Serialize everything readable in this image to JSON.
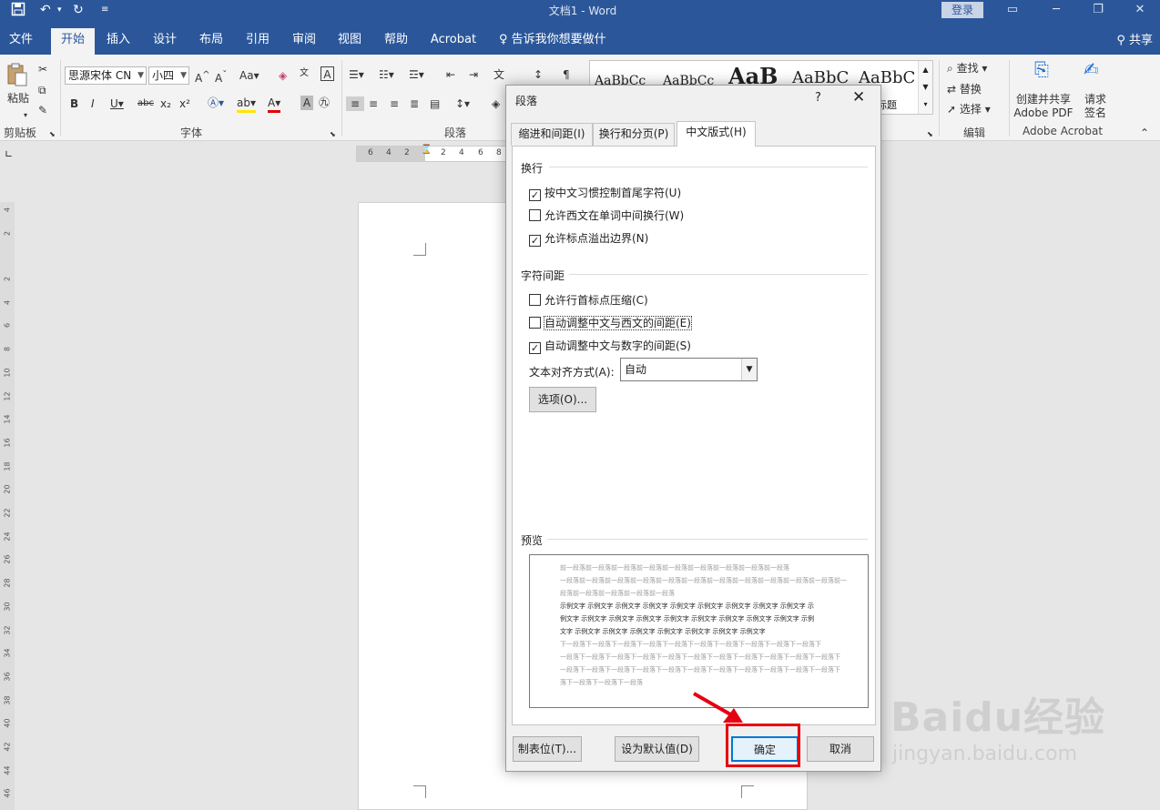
{
  "titlebar": {
    "title": "文档1  -  Word",
    "signin": "登录",
    "save_icon": "save-icon",
    "undo_icon": "undo-icon",
    "redo_icon": "redo-icon",
    "accent": "#2b579a"
  },
  "tabs": [
    {
      "label": "文件"
    },
    {
      "label": "开始"
    },
    {
      "label": "插入"
    },
    {
      "label": "设计"
    },
    {
      "label": "布局"
    },
    {
      "label": "引用"
    },
    {
      "label": "审阅"
    },
    {
      "label": "视图"
    },
    {
      "label": "帮助"
    },
    {
      "label": "Acrobat"
    }
  ],
  "tellme": "告诉我你想要做什么",
  "share": "共享",
  "ribbon": {
    "clipboard": {
      "paste": "粘贴",
      "label": "剪贴板"
    },
    "font": {
      "name": "思源宋体 CN",
      "size": "小四",
      "label": "字体"
    },
    "paragraph": {
      "label": "段落"
    },
    "styles": {
      "samples": [
        "AaBbCc",
        "AaBbCc",
        "AaB",
        "AaBbC",
        "AaBbC"
      ],
      "partial": "标题"
    },
    "editing": {
      "find": "查找",
      "replace": "替换",
      "select": "选择",
      "label": "编辑"
    },
    "acrobat": {
      "create": "创建并共享",
      "create2": "Adobe PDF",
      "request": "请求",
      "request2": "签名",
      "label": "Adobe Acrobat"
    }
  },
  "hruler": [
    "6",
    "4",
    "2",
    "2",
    "4",
    "6",
    "8"
  ],
  "vruler": [
    "4",
    "2",
    "2",
    "4",
    "6",
    "8",
    "10",
    "12",
    "14",
    "16",
    "18",
    "20",
    "22",
    "24",
    "26",
    "28",
    "30",
    "32",
    "34",
    "36",
    "38",
    "40",
    "42",
    "44",
    "46"
  ],
  "dialog": {
    "title": "段落",
    "help": "?",
    "tabs": [
      {
        "label": "缩进和间距(I)",
        "active": false
      },
      {
        "label": "换行和分页(P)",
        "active": false
      },
      {
        "label": "中文版式(H)",
        "active": true
      }
    ],
    "sections": {
      "line_break": "换行",
      "char_spacing": "字符间距",
      "preview": "预览"
    },
    "checks": [
      {
        "label": "按中文习惯控制首尾字符(U)",
        "checked": true
      },
      {
        "label": "允许西文在单词中间换行(W)",
        "checked": false
      },
      {
        "label": "允许标点溢出边界(N)",
        "checked": true
      },
      {
        "label": "允许行首标点压缩(C)",
        "checked": false
      },
      {
        "label": "自动调整中文与西文的间距(E)",
        "checked": false
      },
      {
        "label": "自动调整中文与数字的间距(S)",
        "checked": true
      }
    ],
    "align": {
      "label": "文本对齐方式(A):",
      "value": "自动"
    },
    "options_button": "选项(O)...",
    "preview_text": {
      "before": [
        "前一段落前一段落前一段落前一段落前一段落前一段落前一段落前一段落前一段落",
        "一段落前一段落前一段落前一段落前一段落前一段落前一段落前一段落前一段落前一段落前一段落前一",
        "段落前一段落前一段落前一段落前一段落"
      ],
      "sample": [
        "示例文字 示例文字 示例文字 示例文字 示例文字 示例文字 示例文字 示例文字 示例文字 示",
        "例文字 示例文字 示例文字 示例文字 示例文字 示例文字 示例文字 示例文字 示例文字 示例",
        "文字 示例文字 示例文字 示例文字 示例文字 示例文字 示例文字 示例文字"
      ],
      "after": [
        "下一段落下一段落下一段落下一段落下一段落下一段落下一段落下一段落下一段落下一段落下",
        "一段落下一段落下一段落下一段落下一段落下一段落下一段落下一段落下一段落下一段落下一段落下",
        "一段落下一段落下一段落下一段落下一段落下一段落下一段落下一段落下一段落下一段落下一段落下",
        "落下一段落下一段落下一段落"
      ]
    },
    "buttons": {
      "tabs": "制表位(T)...",
      "default": "设为默认值(D)",
      "ok": "确定",
      "cancel": "取消"
    }
  },
  "watermark": {
    "brand": "Baidu经验",
    "url": "jingyan.baidu.com"
  }
}
